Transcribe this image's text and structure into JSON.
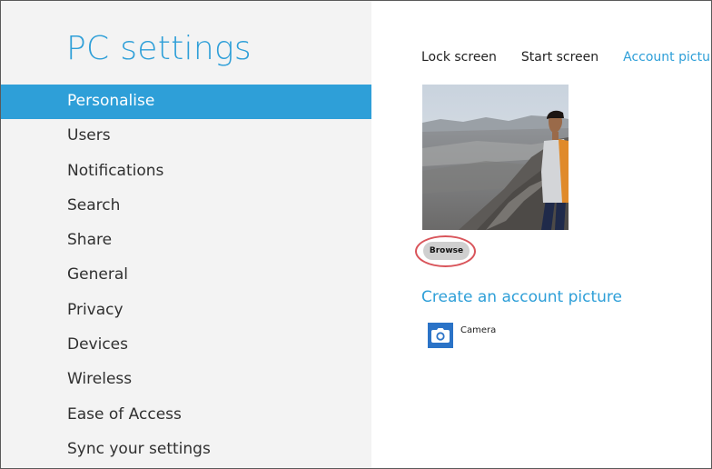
{
  "app": {
    "title": "PC settings"
  },
  "sidebar": {
    "items": [
      {
        "label": "Personalise",
        "active": true
      },
      {
        "label": "Users",
        "active": false
      },
      {
        "label": "Notifications",
        "active": false
      },
      {
        "label": "Search",
        "active": false
      },
      {
        "label": "Share",
        "active": false
      },
      {
        "label": "General",
        "active": false
      },
      {
        "label": "Privacy",
        "active": false
      },
      {
        "label": "Devices",
        "active": false
      },
      {
        "label": "Wireless",
        "active": false
      },
      {
        "label": "Ease of Access",
        "active": false
      },
      {
        "label": "Sync your settings",
        "active": false
      }
    ]
  },
  "tabs": [
    {
      "label": "Lock screen",
      "active": false
    },
    {
      "label": "Start screen",
      "active": false
    },
    {
      "label": "Account picture",
      "active": true
    }
  ],
  "account_picture": {
    "image": "account-photo (person standing on volcanic mountain slope)",
    "browse_label": "Browse"
  },
  "create": {
    "heading": "Create an account picture",
    "apps": [
      {
        "label": "Camera",
        "icon": "camera-icon"
      }
    ]
  },
  "colors": {
    "accent": "#2e9fd8",
    "sidebar_bg": "#f3f3f3",
    "highlight_ring": "#d9555b",
    "camera_tile": "#2b73c7"
  }
}
